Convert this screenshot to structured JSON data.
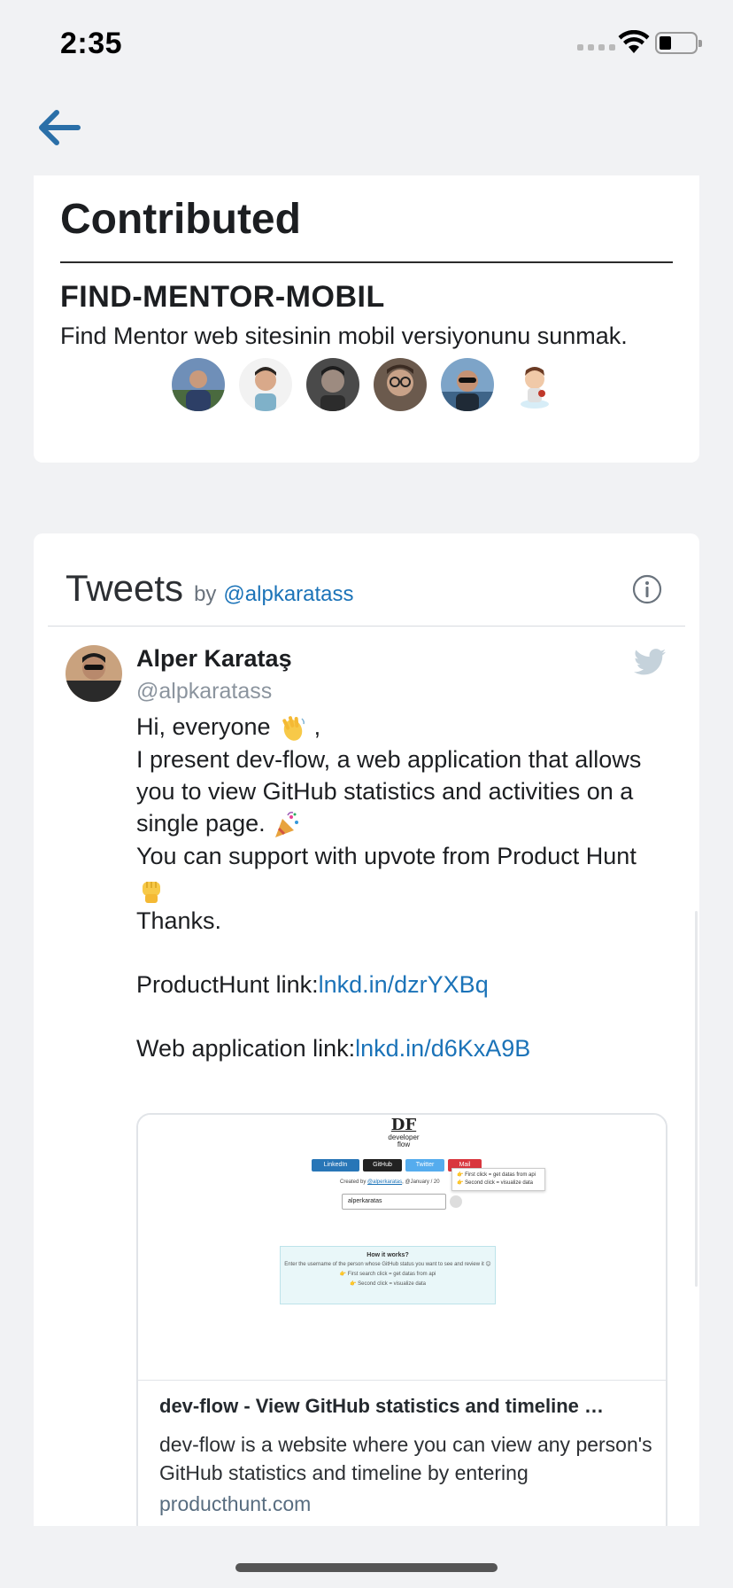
{
  "status_bar": {
    "time": "2:35"
  },
  "contributed": {
    "title": "Contributed",
    "project": {
      "name": "FIND-MENTOR-MOBIL",
      "description": "Find Mentor web sitesinin mobil versiyonunu sunmak.",
      "contributor_count": 6
    }
  },
  "tweets": {
    "title": "Tweets",
    "by": "by",
    "handle": "@alpkaratass",
    "tweet": {
      "author_name": "Alper Karataş",
      "author_handle": "@alpkaratass",
      "lines": {
        "l1": "Hi, everyone",
        "l1_suffix": ",",
        "l2": "I present dev-flow, a web application that allows you to view GitHub statistics and activities on a single page.",
        "l3": "You can support with upvote from Product Hunt",
        "l4": "Thanks.",
        "ph_label": "ProductHunt link:",
        "ph_link": "lnkd.in/dzrYXBq",
        "web_label": "Web application link:",
        "web_link": "lnkd.in/d6KxA9B"
      },
      "preview": {
        "title": "dev-flow - View GitHub statistics and timeline …",
        "description": "dev-flow is a website where you can view any person's GitHub statistics and timeline by entering",
        "domain": "producthunt.com",
        "image": {
          "logo_initials": "DF",
          "logo_text": "developer flow",
          "btn_linkedin": "LinkedIn",
          "btn_github": "GitHub",
          "btn_twitter": "Twitter",
          "btn_mail": "Mail",
          "tip_line1": "👉 First click = get datas from api",
          "tip_line2": "👉 Second click = visualize data",
          "created_by": "Created by",
          "created_user": "@alperkaratas",
          "created_date": ", @January / 20",
          "search_value": "alperkaratas",
          "how_title": "How it works?",
          "how_line1": "Enter the username of the person whose GitHub status you want to see and review it 😊",
          "how_line2": "👉 First search click = get datas from api",
          "how_line3": "👉 Second click = visualize data"
        }
      }
    }
  }
}
